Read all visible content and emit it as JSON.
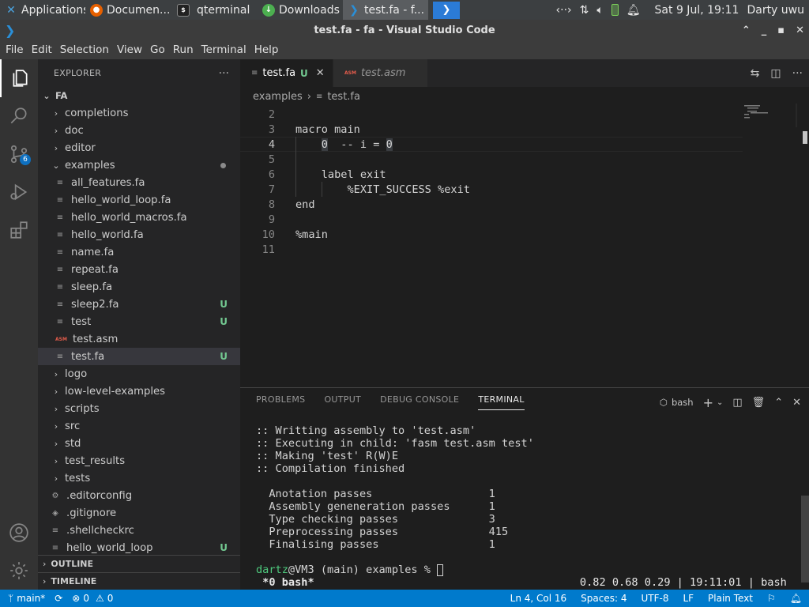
{
  "taskbar": {
    "items": [
      {
        "label": "Applications",
        "icon": "xfce-mouse-icon",
        "color": "#4aa3df"
      },
      {
        "label": "Documen...",
        "icon": "firefox-icon",
        "color": "#e66000"
      },
      {
        "label": "qterminal",
        "icon": "terminal-icon",
        "color": "#222222",
        "badge": "3"
      },
      {
        "label": "Downloads",
        "icon": "download-icon",
        "color": "#4caf50"
      },
      {
        "label": "test.fa - f...",
        "icon": "vscode-icon",
        "color": "#2a8fd8"
      }
    ],
    "clock": "Sat  9 Jul, 19:11",
    "user": "Darty uwu"
  },
  "window": {
    "title": "test.fa - fa - Visual Studio Code"
  },
  "menu": [
    "File",
    "Edit",
    "Selection",
    "View",
    "Go",
    "Run",
    "Terminal",
    "Help"
  ],
  "activity": {
    "scm_badge": "6"
  },
  "explorer": {
    "header": "EXPLORER",
    "more": "···",
    "root": "FA",
    "tree": [
      {
        "label": "completions",
        "type": "folder",
        "depth": 1
      },
      {
        "label": "doc",
        "type": "folder",
        "depth": 1
      },
      {
        "label": "editor",
        "type": "folder",
        "depth": 1
      },
      {
        "label": "examples",
        "type": "folder-open",
        "depth": 1,
        "dot": true
      },
      {
        "label": "all_features.fa",
        "type": "file",
        "depth": 2
      },
      {
        "label": "hello_world_loop.fa",
        "type": "file",
        "depth": 2
      },
      {
        "label": "hello_world_macros.fa",
        "type": "file",
        "depth": 2
      },
      {
        "label": "hello_world.fa",
        "type": "file",
        "depth": 2
      },
      {
        "label": "name.fa",
        "type": "file",
        "depth": 2
      },
      {
        "label": "repeat.fa",
        "type": "file",
        "depth": 2
      },
      {
        "label": "sleep.fa",
        "type": "file",
        "depth": 2
      },
      {
        "label": "sleep2.fa",
        "type": "file",
        "depth": 2,
        "status": "U"
      },
      {
        "label": "test",
        "type": "file",
        "depth": 2,
        "status": "U"
      },
      {
        "label": "test.asm",
        "type": "asm",
        "depth": 2
      },
      {
        "label": "test.fa",
        "type": "file",
        "depth": 2,
        "status": "U",
        "selected": true
      },
      {
        "label": "logo",
        "type": "folder",
        "depth": 1
      },
      {
        "label": "low-level-examples",
        "type": "folder",
        "depth": 1
      },
      {
        "label": "scripts",
        "type": "folder",
        "depth": 1
      },
      {
        "label": "src",
        "type": "folder",
        "depth": 1
      },
      {
        "label": "std",
        "type": "folder",
        "depth": 1
      },
      {
        "label": "test_results",
        "type": "folder",
        "depth": 1
      },
      {
        "label": "tests",
        "type": "folder",
        "depth": 1
      },
      {
        "label": ".editorconfig",
        "type": "gear",
        "depth": 1
      },
      {
        "label": ".gitignore",
        "type": "git",
        "depth": 1
      },
      {
        "label": ".shellcheckrc",
        "type": "file",
        "depth": 1
      },
      {
        "label": "hello_world_loop",
        "type": "file",
        "depth": 1,
        "status": "U"
      }
    ],
    "outline": "OUTLINE",
    "timeline": "TIMELINE"
  },
  "tabs": [
    {
      "label": "test.fa",
      "modified": "U",
      "active": true
    },
    {
      "label": "test.asm",
      "active": false,
      "preview": true,
      "asm_badge": "ASM"
    }
  ],
  "breadcrumb": [
    "examples",
    "test.fa"
  ],
  "code": [
    {
      "n": "2",
      "text": ""
    },
    {
      "n": "3",
      "text": "macro main"
    },
    {
      "n": "4",
      "text": "    0  -- i = 0",
      "current": true
    },
    {
      "n": "5",
      "text": ""
    },
    {
      "n": "6",
      "text": "    label exit"
    },
    {
      "n": "7",
      "text": "        %EXIT_SUCCESS %exit"
    },
    {
      "n": "8",
      "text": "end"
    },
    {
      "n": "9",
      "text": ""
    },
    {
      "n": "10",
      "text": "%main"
    },
    {
      "n": "11",
      "text": ""
    }
  ],
  "panel": {
    "tabs": [
      "PROBLEMS",
      "OUTPUT",
      "DEBUG CONSOLE",
      "TERMINAL"
    ],
    "active_tab": "TERMINAL",
    "shell": "bash",
    "terminal_lines": [
      ":: Writting assembly to 'test.asm'",
      ":: Executing in child: 'fasm test.asm test'",
      ":: Making 'test' R(W)E",
      ":: Compilation finished",
      "",
      "  Anotation passes                  1",
      "  Assembly geneneration passes      1",
      "  Type checking passes              3",
      "  Preprocessing passes              415",
      "  Finalising passes                 1"
    ],
    "prompt_user": "dartz",
    "prompt_rest": "@VM3 (main) examples % ",
    "tmux_left": " *0 bash*",
    "tmux_right": "0.82 0.68 0.29 | 19:11:01 | bash "
  },
  "status": {
    "branch": "main*",
    "errors": "0",
    "warnings": "0",
    "position": "Ln 4, Col 16",
    "spaces": "Spaces: 4",
    "encoding": "UTF-8",
    "eol": "LF",
    "language": "Plain Text"
  }
}
